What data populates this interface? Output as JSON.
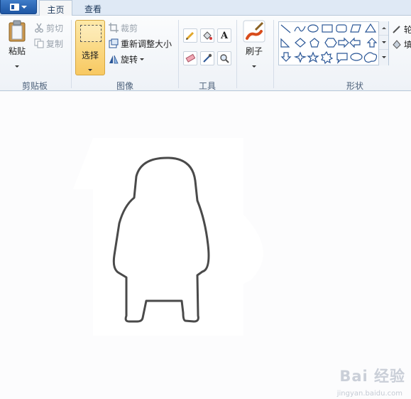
{
  "tabs": {
    "home": "主页",
    "view": "查看"
  },
  "clipboard": {
    "paste": "粘贴",
    "cut": "剪切",
    "copy": "复制",
    "group": "剪贴板"
  },
  "image": {
    "select": "选择",
    "crop": "裁剪",
    "resize": "重新调整大小",
    "rotate": "旋转",
    "group": "图像"
  },
  "tools": {
    "group": "工具",
    "items": [
      "pencil-icon",
      "fill-icon",
      "text-icon",
      "eraser-icon",
      "color-picker-icon",
      "magnifier-icon"
    ]
  },
  "brushes": {
    "label": "刷子"
  },
  "shapes": {
    "group": "形状",
    "outline_label": "轮",
    "fill_label": "填"
  },
  "watermark": {
    "brand": "Bai 经验",
    "url": "jingyan.baidu.com"
  },
  "colors": {
    "accent": "#2b5797",
    "select_bg": "#f8c962",
    "outline": "#4a4a4a"
  }
}
